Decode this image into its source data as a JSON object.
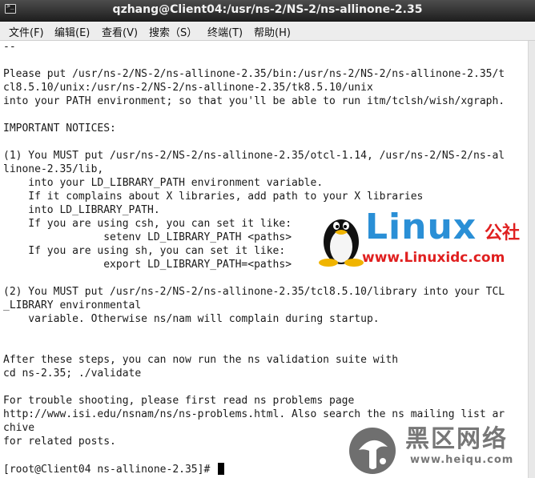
{
  "window": {
    "title": "qzhang@Client04:/usr/ns-2/NS-2/ns-allinone-2.35"
  },
  "menu": {
    "items": [
      "文件(F)",
      "编辑(E)",
      "查看(V)",
      "搜索（S）",
      "终端(T)",
      "帮助(H)"
    ]
  },
  "terminal": {
    "lines": [
      "--",
      "",
      "Please put /usr/ns-2/NS-2/ns-allinone-2.35/bin:/usr/ns-2/NS-2/ns-allinone-2.35/t",
      "cl8.5.10/unix:/usr/ns-2/NS-2/ns-allinone-2.35/tk8.5.10/unix",
      "into your PATH environment; so that you'll be able to run itm/tclsh/wish/xgraph.",
      "",
      "IMPORTANT NOTICES:",
      "",
      "(1) You MUST put /usr/ns-2/NS-2/ns-allinone-2.35/otcl-1.14, /usr/ns-2/NS-2/ns-al",
      "linone-2.35/lib,",
      "    into your LD_LIBRARY_PATH environment variable.",
      "    If it complains about X libraries, add path to your X libraries",
      "    into LD_LIBRARY_PATH.",
      "    If you are using csh, you can set it like:",
      "                setenv LD_LIBRARY_PATH <paths>",
      "    If you are using sh, you can set it like:",
      "                export LD_LIBRARY_PATH=<paths>",
      "",
      "(2) You MUST put /usr/ns-2/NS-2/ns-allinone-2.35/tcl8.5.10/library into your TCL",
      "_LIBRARY environmental",
      "    variable. Otherwise ns/nam will complain during startup.",
      "",
      "",
      "After these steps, you can now run the ns validation suite with",
      "cd ns-2.35; ./validate",
      "",
      "For trouble shooting, please first read ns problems page",
      "http://www.isi.edu/nsnam/ns/ns-problems.html. Also search the ns mailing list ar",
      "chive",
      "for related posts.",
      "",
      ""
    ],
    "prompt": "[root@Client04 ns-allinone-2.35]#"
  },
  "watermark": {
    "brand": "Linux",
    "brand_suffix": "公社",
    "url": "www.Linuxidc.com",
    "site2_name": "黑区网络",
    "site2_url": "www.heiqu.com"
  },
  "colors": {
    "titlebar": "#2b2b2b",
    "menubar": "#ededed",
    "terminal_bg": "#ffffff",
    "terminal_fg": "#1a1a1a",
    "brand_blue": "#2a8fd6",
    "brand_red": "#e02020"
  }
}
